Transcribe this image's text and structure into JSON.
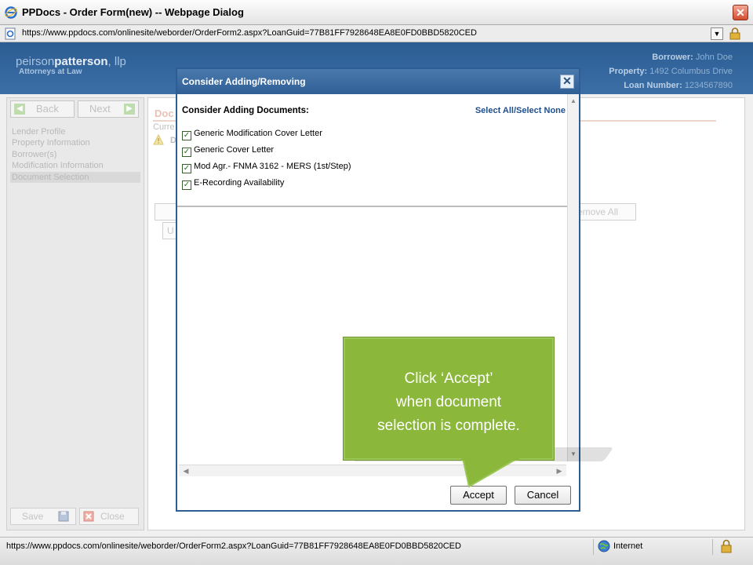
{
  "window": {
    "title": "PPDocs - Order Form(new) -- Webpage Dialog",
    "close_glyph": "✕",
    "url": "https://www.ppdocs.com/onlinesite/weborder/OrderForm2.aspx?LoanGuid=77B81FF7928648EA8E0FD0BBD5820CED"
  },
  "banner": {
    "logo_part1": "peirson",
    "logo_part2": "patterson",
    "logo_part3": ", llp",
    "logo_sub": "Attorneys at Law",
    "borrower_label": "Borrower:",
    "borrower_value": "John Doe",
    "property_label": "Property:",
    "property_value": "1492 Columbus Drive",
    "loan_label": "Loan Number:",
    "loan_value": "1234567890"
  },
  "nav": {
    "back_label": "Back",
    "next_label": "Next",
    "steps": [
      "Lender Profile",
      "Property Information",
      "Borrower(s)",
      "Modification Information",
      "Document Selection"
    ],
    "current_step": "Document Selection",
    "save_label": "Save",
    "close_label": "Close"
  },
  "main": {
    "header": "Doc",
    "current_text": "Curre",
    "doc_text": "D",
    "remove_all_fragment": "emove All",
    "u_fragment": "U"
  },
  "modal": {
    "title": "Consider Adding/Removing",
    "close_glyph": "✕",
    "list_heading": "Consider Adding Documents:",
    "select_all": "Select All",
    "select_separator": "/",
    "select_none": "Select None",
    "check_glyph": "✓",
    "items": [
      {
        "label": "Generic Modification Cover Letter",
        "checked": true
      },
      {
        "label": "Generic Cover Letter",
        "checked": true
      },
      {
        "label": "Mod Agr.- FNMA 3162 - MERS (1st/Step)",
        "checked": true
      },
      {
        "label": "E-Recording Availability",
        "checked": true
      }
    ],
    "accept_label": "Accept",
    "cancel_label": "Cancel"
  },
  "callout": {
    "line1": "Click ‘Accept’",
    "line2": "when document",
    "line3": "selection is complete."
  },
  "status": {
    "url": "https://www.ppdocs.com/onlinesite/weborder/OrderForm2.aspx?LoanGuid=77B81FF7928648EA8E0FD0BBD5820CED",
    "zone": "Internet"
  },
  "colors": {
    "banner_blue": "#2f5f95",
    "callout_green": "#8bb73b",
    "link_blue": "#1f4f8f"
  }
}
